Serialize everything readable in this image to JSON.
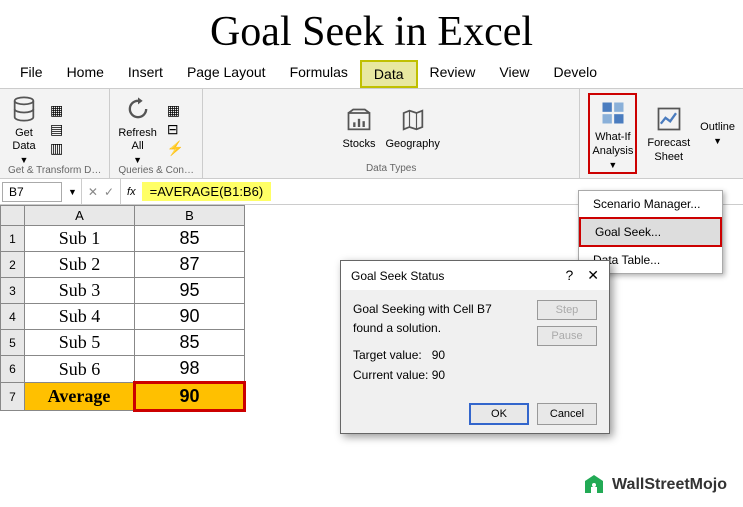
{
  "title": "Goal Seek in Excel",
  "tabs": [
    "File",
    "Home",
    "Insert",
    "Page Layout",
    "Formulas",
    "Data",
    "Review",
    "View",
    "Develo"
  ],
  "active_tab": "Data",
  "ribbon": {
    "group1": {
      "label": "Get & Transform D…",
      "btn": "Get\nData"
    },
    "group2": {
      "label": "Queries & Con…",
      "btn": "Refresh\nAll"
    },
    "group3": {
      "label": "Data Types",
      "btn1": "Stocks",
      "btn2": "Geography"
    },
    "group4": {
      "btn1": "What-If\nAnalysis",
      "btn2": "Forecast\nSheet",
      "btn3": "Outline"
    }
  },
  "dropdown": {
    "item1": "Scenario Manager...",
    "item2": "Goal Seek...",
    "item3": "Data Table..."
  },
  "formula_bar": {
    "name_box": "B7",
    "formula": "=AVERAGE(B1:B6)"
  },
  "sheet": {
    "cols": [
      "A",
      "B"
    ],
    "rows": [
      {
        "n": "1",
        "a": "Sub 1",
        "b": "85"
      },
      {
        "n": "2",
        "a": "Sub 2",
        "b": "87"
      },
      {
        "n": "3",
        "a": "Sub 3",
        "b": "95"
      },
      {
        "n": "4",
        "a": "Sub 4",
        "b": "90"
      },
      {
        "n": "5",
        "a": "Sub 5",
        "b": "85"
      },
      {
        "n": "6",
        "a": "Sub 6",
        "b": "98"
      }
    ],
    "avg_row": {
      "n": "7",
      "a": "Average",
      "b": "90"
    }
  },
  "dialog": {
    "title": "Goal Seek Status",
    "line1": "Goal Seeking with Cell B7",
    "line2": "found a solution.",
    "target_label": "Target value:",
    "target_value": "90",
    "current_label": "Current value:",
    "current_value": "90",
    "step": "Step",
    "pause": "Pause",
    "ok": "OK",
    "cancel": "Cancel"
  },
  "watermark": "WallStreetMojo"
}
